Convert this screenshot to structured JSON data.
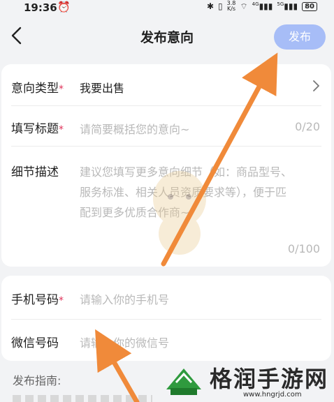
{
  "status_bar": {
    "time": "19:36",
    "alarm_icon": "alarm-icon",
    "speed_value": "3.8",
    "speed_unit": "K/s",
    "net1": "4G",
    "net2": "5G",
    "battery": "80"
  },
  "header": {
    "title": "发布意向",
    "publish_label": "发布",
    "publish_color": "#a7bdf7"
  },
  "form": {
    "type": {
      "label": "意向类型",
      "required": "*",
      "value": "我要出售"
    },
    "title": {
      "label": "填写标题",
      "required": "*",
      "placeholder": "请简要概括您的意向~",
      "counter": "0/20"
    },
    "detail": {
      "label": "细节描述",
      "placeholder_lines": [
        "建议您填写更多意向细节（如：商品型号、",
        "服务标准、相关人员资质要求等），便于匹",
        "配到更多优质合作商~"
      ],
      "counter": "0/100"
    },
    "phone": {
      "label": "手机号码",
      "required": "*",
      "placeholder": "请输入你的手机号"
    },
    "wechat": {
      "label": "微信号码",
      "placeholder": "请输入你的微信号"
    }
  },
  "guide": {
    "label": "发布指南:"
  },
  "watermark": {
    "text": "格润手游网",
    "url": "www.hngrjd.com"
  },
  "annotations": {
    "arrow_color": "#f08a3a"
  }
}
